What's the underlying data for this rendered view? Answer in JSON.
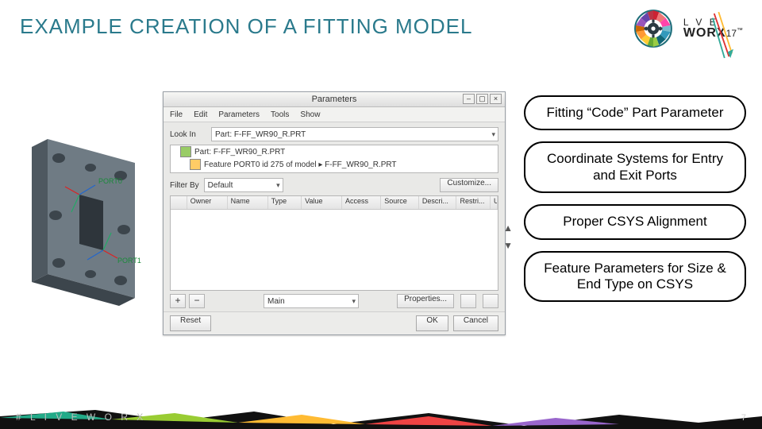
{
  "title": "EXAMPLE CREATION OF A FITTING MODEL",
  "logos": {
    "worx_line1": "L   V E",
    "worx_line2": "WORX",
    "worx_year": "17"
  },
  "part": {
    "port0": "PORT0",
    "port1": "PORT1"
  },
  "dialog": {
    "title": "Parameters",
    "menu": [
      "File",
      "Edit",
      "Parameters",
      "Tools",
      "Show"
    ],
    "lookin_label": "Look In",
    "lookin_value": "Part: F-FF_WR90_R.PRT",
    "tree": [
      {
        "icon": "part",
        "label": "Part: F-FF_WR90_R.PRT"
      },
      {
        "icon": "feat",
        "label": "Feature PORT0 id 275 of model ▸ F-FF_WR90_R.PRT"
      }
    ],
    "filter_label": "Filter By",
    "filter_value": "Default",
    "customize": "Customize...",
    "grid_headers": [
      "",
      "Owner",
      "Name",
      "Type",
      "Value",
      "Access",
      "Source",
      "Descri...",
      "Restri...",
      "Uni"
    ],
    "add": "+",
    "remove": "−",
    "main_value": "Main",
    "properties": "Properties...",
    "reset": "Reset",
    "ok": "OK",
    "cancel": "Cancel"
  },
  "callouts": [
    "Fitting “Code” Part Parameter",
    "Coordinate Systems for Entry and Exit Ports",
    "Proper CSYS Alignment",
    "Feature Parameters for Size & End Type on CSYS"
  ],
  "footer": {
    "hashtag": "# L I V E W O R X",
    "page": "7"
  }
}
